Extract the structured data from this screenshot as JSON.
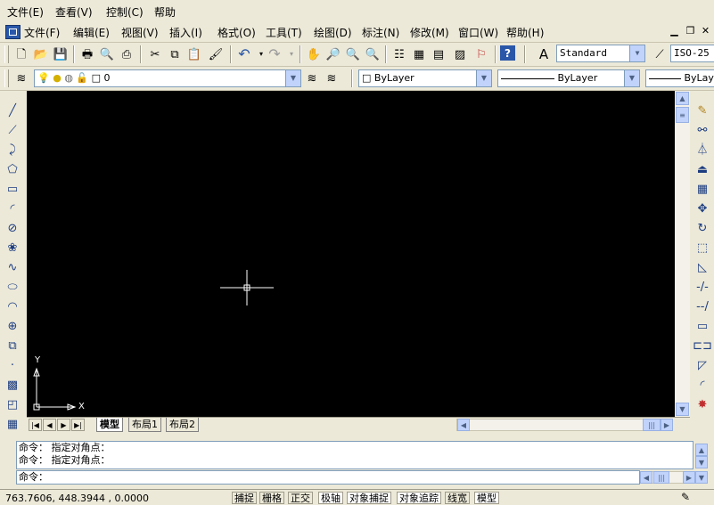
{
  "outer_menu": {
    "items": [
      "文件(E)",
      "查看(V)",
      "控制(C)",
      "帮助"
    ]
  },
  "inner_menu": {
    "items": [
      "文件(F)",
      "编辑(E)",
      "视图(V)",
      "插入(I)",
      "格式(O)",
      "工具(T)",
      "绘图(D)",
      "标注(N)",
      "修改(M)",
      "窗口(W)",
      "帮助(H)"
    ]
  },
  "standard_toolbar": {
    "text_style": "Standard",
    "dim_style": "ISO-25"
  },
  "layers_toolbar": {
    "current_layer": "0",
    "color": "ByLayer",
    "linetype": "ByLayer",
    "lineweight": "ByLayer"
  },
  "canvas": {
    "background": "#000000",
    "ucs_x_label": "X",
    "ucs_y_label": "Y"
  },
  "layout_tabs": [
    "模型",
    "布局1",
    "布局2"
  ],
  "active_tab": "模型",
  "command_window": {
    "history": [
      "命令： 指定对角点：",
      "命令： 指定对角点："
    ],
    "prompt": "命令："
  },
  "status_bar": {
    "coordinates": "763.7606,  448.3944 , 0.0000",
    "toggles": [
      "捕捉",
      "栅格",
      "正交",
      "极轴",
      "对象捕捉",
      "对象追踪",
      "线宽",
      "模型"
    ]
  },
  "colors": {
    "chrome": "#ece9d8",
    "canvas": "#000000",
    "crosshair": "#ffffff",
    "scroll_button": "#c1d3fb"
  }
}
